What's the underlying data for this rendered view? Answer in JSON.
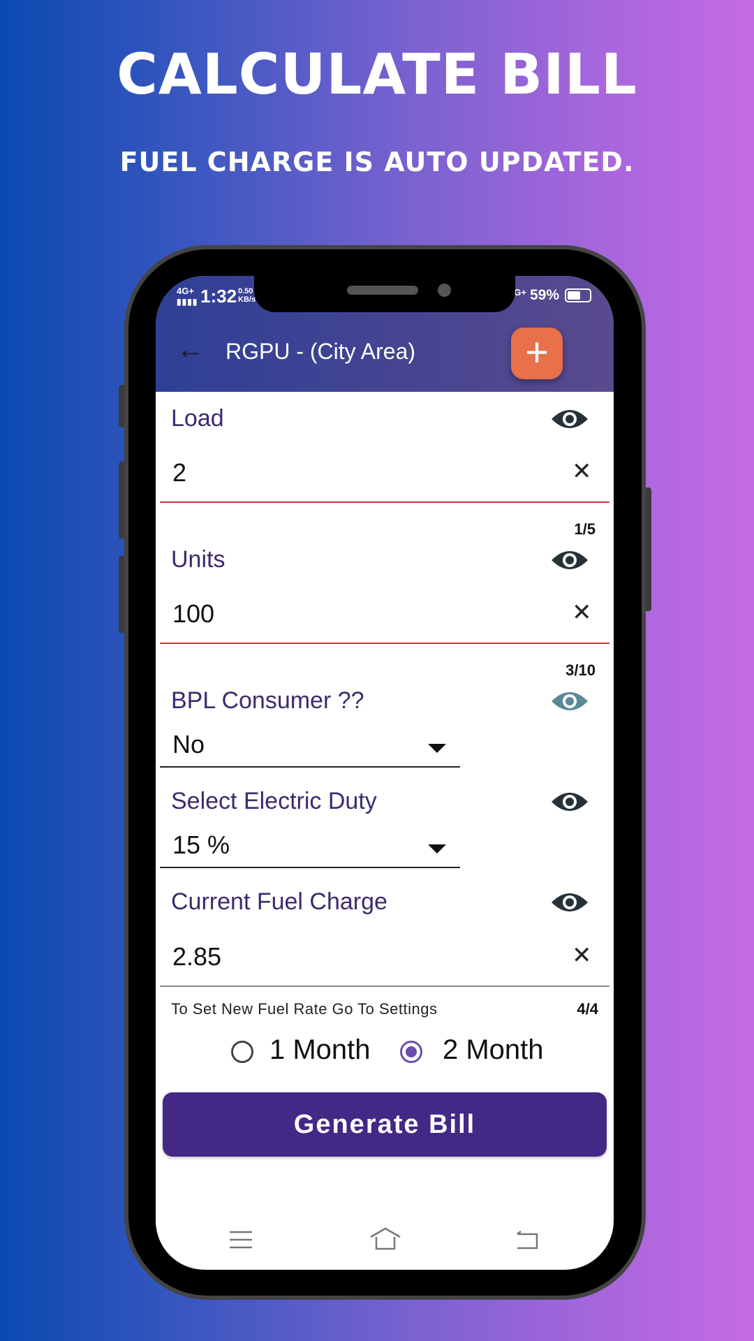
{
  "promo": {
    "title": "CALCULATE BILL",
    "subtitle": "FUEL CHARGE IS AUTO UPDATED."
  },
  "status_bar": {
    "network": "4G+",
    "time": "1:32",
    "speed": "0.50 KB/s",
    "network_right": "4G+",
    "battery": "59%",
    "battery_level": 0.59
  },
  "app_bar": {
    "title": "RGPU - (City Area)",
    "back_icon": "arrow-left-icon",
    "add_icon": "plus-icon",
    "accent": "#e8704a"
  },
  "form": {
    "load": {
      "label": "Load",
      "value": "2",
      "counter": "1/5"
    },
    "units": {
      "label": "Units",
      "value": "100",
      "counter": "3/10"
    },
    "bpl": {
      "label": "BPL Consumer  ??",
      "selected": "No"
    },
    "duty": {
      "label": "Select Electric Duty",
      "selected": "15 %"
    },
    "fuel": {
      "label": "Current Fuel Charge",
      "value": "2.85",
      "helper": "To Set New Fuel Rate Go To Settings",
      "counter": "4/4"
    },
    "period": {
      "options": [
        "1 Month",
        "2 Month"
      ],
      "selected": "2 Month"
    },
    "generate_label": "Generate Bill"
  },
  "colors": {
    "primary": "#432886",
    "error_underline": "#c0393b",
    "label": "#3d2a6e"
  },
  "nav": {
    "icons": [
      "menu-icon",
      "home-icon",
      "back-icon"
    ]
  }
}
